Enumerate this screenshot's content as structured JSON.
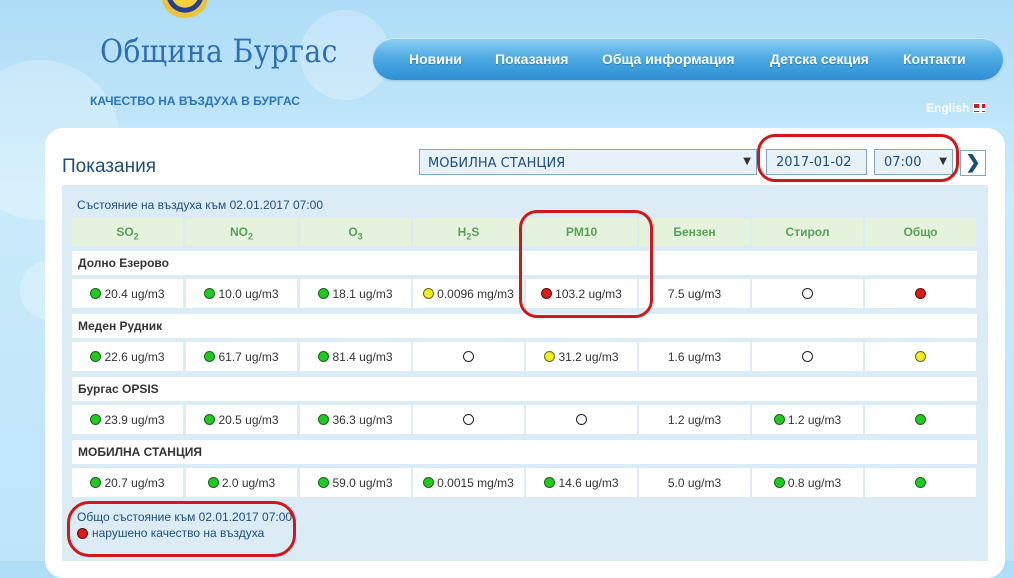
{
  "brand": {
    "name": "Община Бургас",
    "tagline": "КАЧЕСТВО НА ВЪЗДУХА В БУРГАС"
  },
  "nav": {
    "items": [
      "Новини",
      "Показания",
      "Обща информация",
      "Детска секция",
      "Контакти"
    ]
  },
  "lang": {
    "label": "English"
  },
  "page": {
    "title": "Показания"
  },
  "controls": {
    "station": "МОБИЛНА СТАНЦИЯ",
    "date": "2017-01-02",
    "time": "07:00"
  },
  "table": {
    "status_title": "Състояние на въздуха към 02.01.2017 07:00",
    "headers": [
      {
        "main": "SO",
        "sub": "2"
      },
      {
        "main": "NO",
        "sub": "2"
      },
      {
        "main": "O",
        "sub": "3"
      },
      {
        "main": "H",
        "sub": "2",
        "tail": "S"
      },
      {
        "main": "PM10",
        "sub": ""
      },
      {
        "main": "Бензен",
        "sub": ""
      },
      {
        "main": "Стирол",
        "sub": ""
      },
      {
        "main": "Общо",
        "sub": ""
      }
    ],
    "stations": [
      {
        "name": "Долно Езерово",
        "cells": [
          {
            "dot": "green",
            "text": "20.4 ug/m3"
          },
          {
            "dot": "green",
            "text": "10.0 ug/m3"
          },
          {
            "dot": "green",
            "text": "18.1 ug/m3"
          },
          {
            "dot": "yellow",
            "text": "0.0096 mg/m3"
          },
          {
            "dot": "red",
            "text": "103.2 ug/m3"
          },
          {
            "dot": "",
            "text": "7.5 ug/m3"
          },
          {
            "dot": "white",
            "text": ""
          },
          {
            "dot": "red",
            "text": ""
          }
        ]
      },
      {
        "name": "Меден Рудник",
        "cells": [
          {
            "dot": "green",
            "text": "22.6 ug/m3"
          },
          {
            "dot": "green",
            "text": "61.7 ug/m3"
          },
          {
            "dot": "green",
            "text": "81.4 ug/m3"
          },
          {
            "dot": "white",
            "text": ""
          },
          {
            "dot": "yellow",
            "text": "31.2 ug/m3"
          },
          {
            "dot": "",
            "text": "1.6 ug/m3"
          },
          {
            "dot": "white",
            "text": ""
          },
          {
            "dot": "yellow",
            "text": ""
          }
        ]
      },
      {
        "name": "Бургас OPSIS",
        "cells": [
          {
            "dot": "green",
            "text": "23.9 ug/m3"
          },
          {
            "dot": "green",
            "text": "20.5 ug/m3"
          },
          {
            "dot": "green",
            "text": "36.3 ug/m3"
          },
          {
            "dot": "white",
            "text": ""
          },
          {
            "dot": "white",
            "text": ""
          },
          {
            "dot": "",
            "text": "1.2 ug/m3"
          },
          {
            "dot": "green",
            "text": "1.2 ug/m3"
          },
          {
            "dot": "green",
            "text": ""
          }
        ]
      },
      {
        "name": "МОБИЛНА СТАНЦИЯ",
        "cells": [
          {
            "dot": "green",
            "text": "20.7 ug/m3"
          },
          {
            "dot": "green",
            "text": "2.0 ug/m3"
          },
          {
            "dot": "green",
            "text": "59.0 ug/m3"
          },
          {
            "dot": "green",
            "text": "0.0015 mg/m3"
          },
          {
            "dot": "green",
            "text": "14.6 ug/m3"
          },
          {
            "dot": "",
            "text": "5.0 ug/m3"
          },
          {
            "dot": "green",
            "text": "0.8 ug/m3"
          },
          {
            "dot": "green",
            "text": ""
          }
        ]
      }
    ]
  },
  "legend": {
    "title": "Общо състояние към 02.01.2017 07:00",
    "status_dot": "red",
    "status_text": "нарушено качество на въздуха"
  },
  "colors": {
    "accent": "#2c6fb6",
    "header_green": "#57a05a",
    "annotation_red": "#d11818"
  }
}
